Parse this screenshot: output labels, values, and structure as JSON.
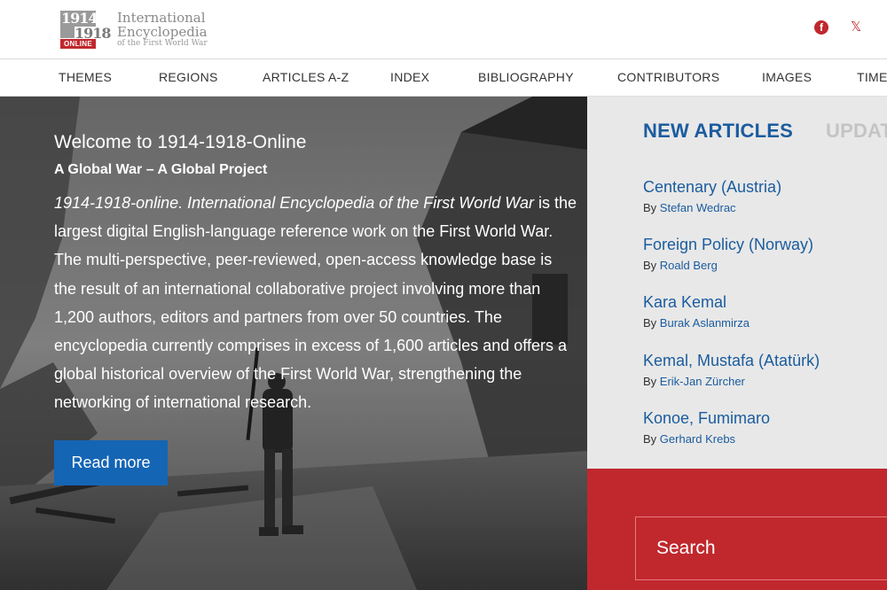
{
  "logo": {
    "year1": "1914",
    "year2": "1918",
    "online": "ONLINE",
    "line1": "International",
    "line2": "Encyclopedia",
    "line3": "of the First World War"
  },
  "social": {
    "facebook_icon": "facebook-icon",
    "x_icon": "x-icon",
    "facebook_glyph": "f",
    "x_glyph": "𝕏"
  },
  "nav": {
    "items": [
      "THEMES",
      "REGIONS",
      "ARTICLES A-Z",
      "INDEX",
      "BIBLIOGRAPHY",
      "CONTRIBUTORS",
      "IMAGES",
      "TIME"
    ]
  },
  "hero": {
    "title": "Welcome to 1914-1918-Online",
    "subtitle": "A Global War – A Global Project",
    "body_italic": "1914-1918-online. International Encyclopedia of the First World War",
    "body_rest": " is the largest digital English-language reference work on the First World War. The multi-perspective, peer-reviewed, open-access knowledge base is the result of an international collaborative project involving more than 1,200 authors, editors and partners from over 50 countries. The encyclopedia currently comprises in excess of 1,600 articles and offers a global historical overview of the First World War, strengthening the networking of international research.",
    "read_more": "Read more"
  },
  "tabs": {
    "new": "NEW ARTICLES",
    "updated": "UPDAT"
  },
  "articles": [
    {
      "title": "Centenary (Austria)",
      "by": "By ",
      "author": "Stefan Wedrac"
    },
    {
      "title": "Foreign Policy (Norway)",
      "by": "By ",
      "author": "Roald Berg"
    },
    {
      "title": "Kara Kemal",
      "by": "By ",
      "author": "Burak Aslanmirza"
    },
    {
      "title": "Kemal, Mustafa (Atatürk)",
      "by": "By ",
      "author": "Erik-Jan Zürcher"
    },
    {
      "title": "Konoe, Fumimaro",
      "by": "By ",
      "author": "Gerhard Krebs"
    }
  ],
  "search": {
    "placeholder": "Search"
  },
  "colors": {
    "brand_red": "#c0282d",
    "link_blue": "#1b5c9e",
    "button_blue": "#1565b5"
  }
}
